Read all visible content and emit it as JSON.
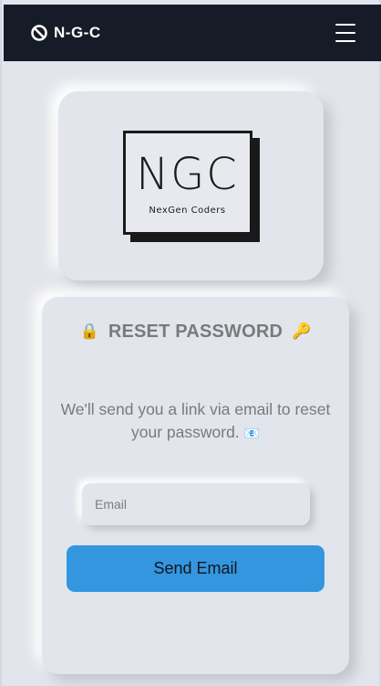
{
  "navbar": {
    "brand": "N-G-C",
    "brand_icon": "ngc-logo-icon",
    "menu_icon": "hamburger-menu-icon",
    "background": "#161b28"
  },
  "logo": {
    "big_text": "NGC",
    "sub_text": "NexGen Coders"
  },
  "form": {
    "title": "RESET PASSWORD",
    "title_left_icon": "lock-icon",
    "title_right_icon": "key-icon",
    "description": "We'll send you a link via email to reset your password.",
    "description_icon": "envelope-icon",
    "email_placeholder": "Email",
    "email_value": "",
    "submit_label": "Send Email",
    "accent": "#3596e0"
  }
}
